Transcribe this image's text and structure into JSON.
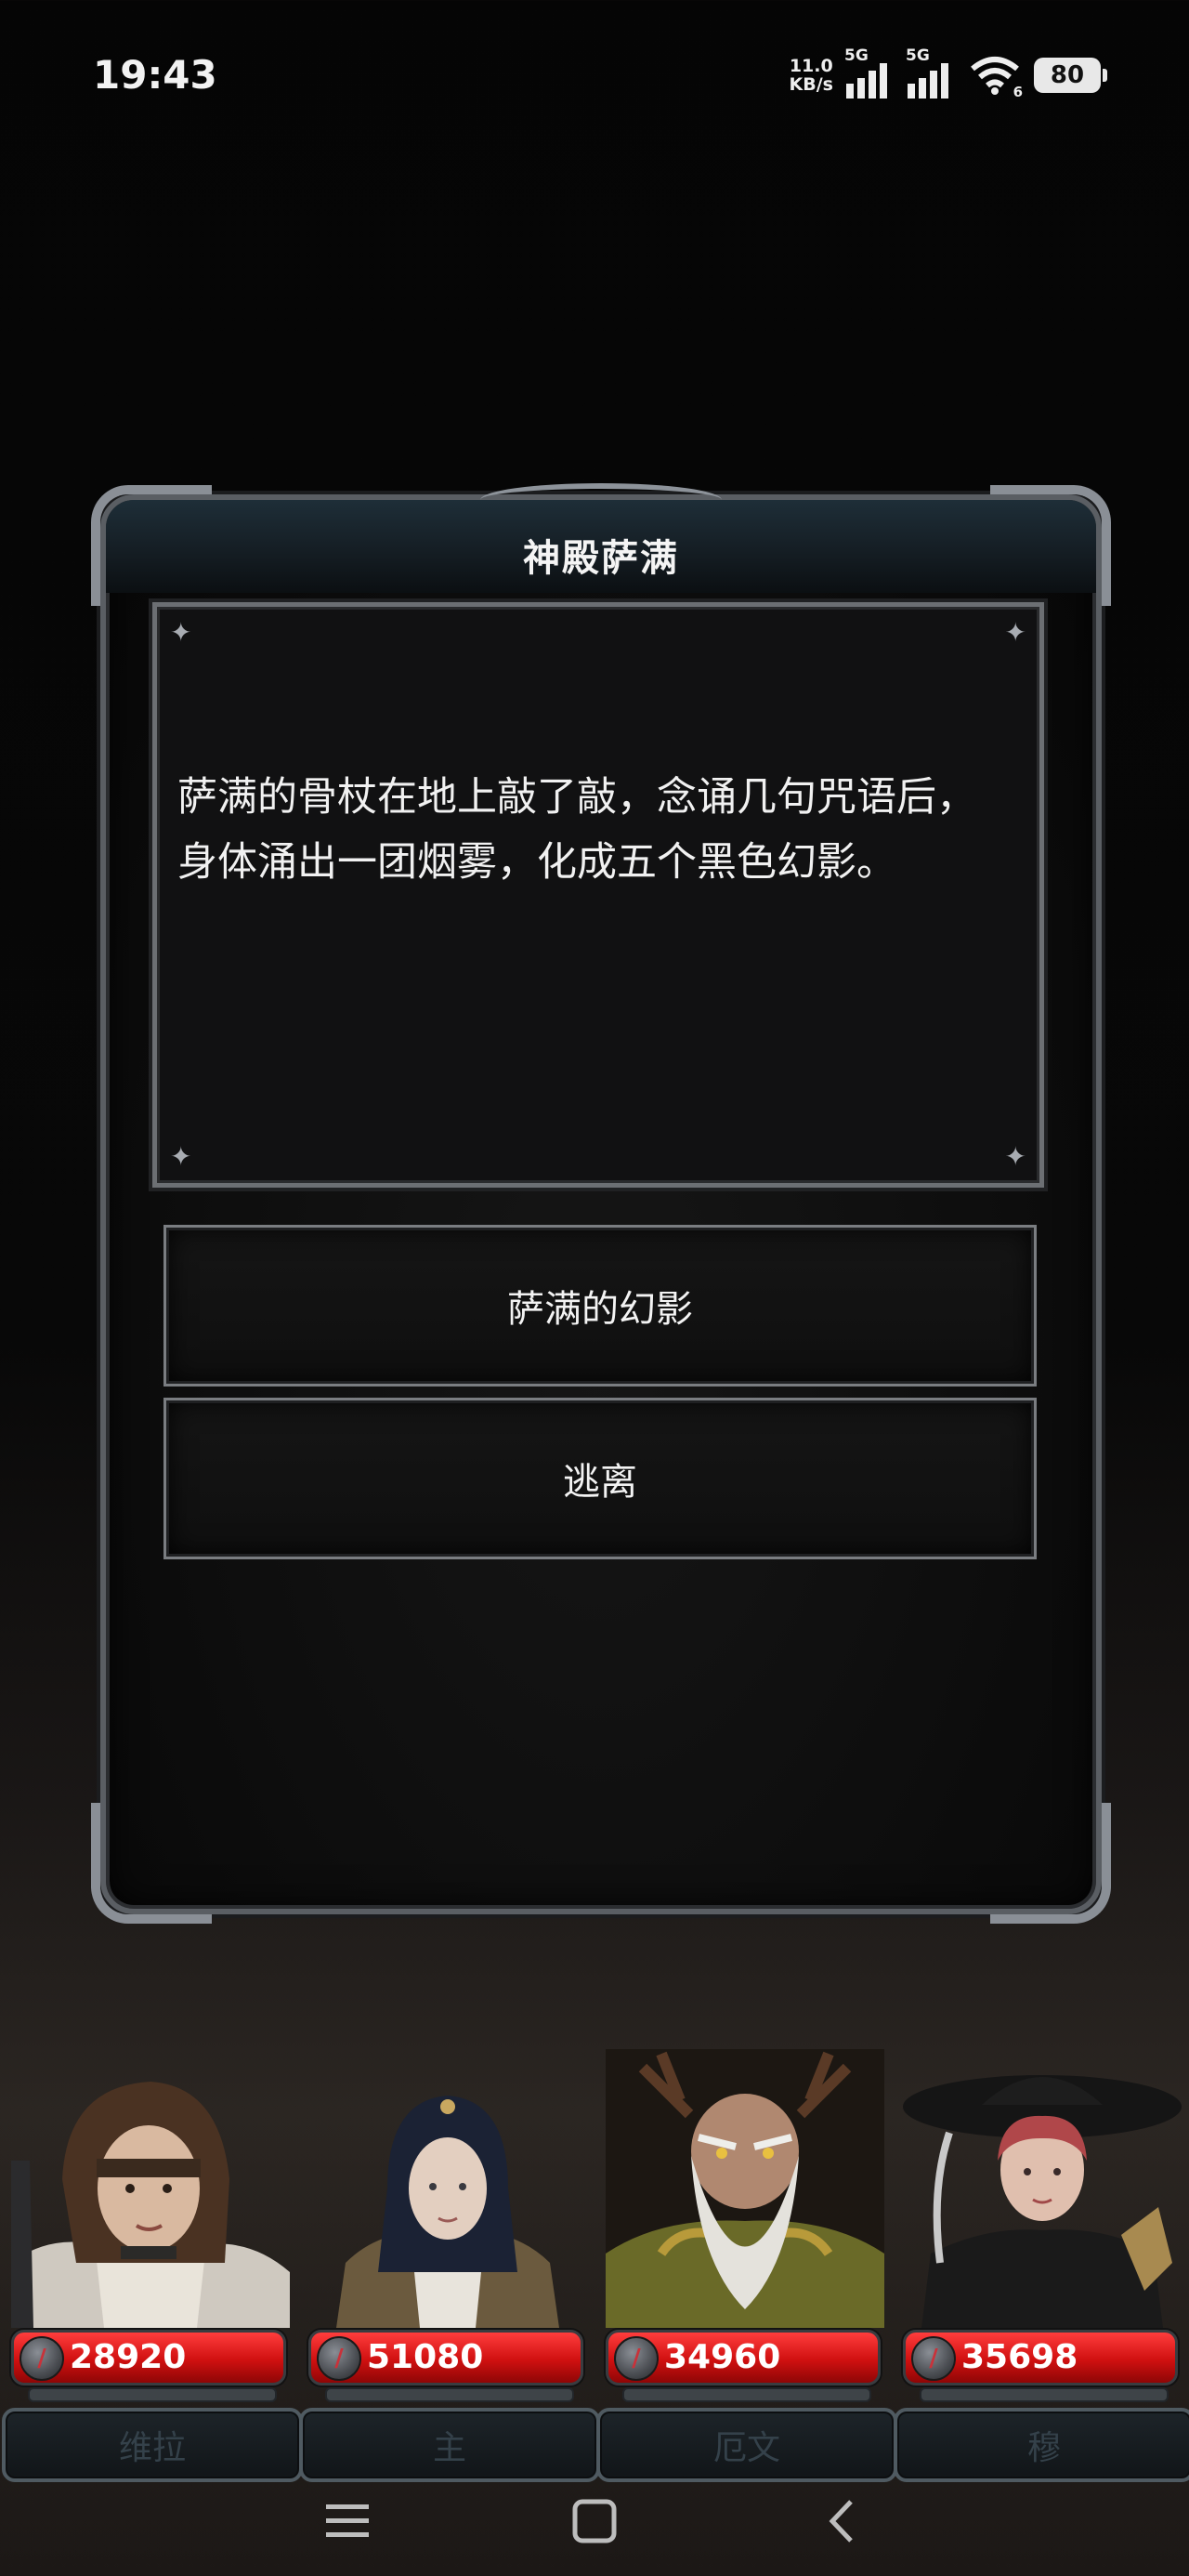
{
  "status_bar": {
    "time": "19:43",
    "net_speed_value": "11.0",
    "net_speed_unit": "KB/s",
    "sim1_label": "5G",
    "sim2_label": "5G",
    "wifi_badge": "6",
    "battery": "80"
  },
  "dialog": {
    "title": "神殿萨满",
    "story": "萨满的骨杖在地上敲了敲，念诵几句咒语后，身体涌出一团烟雾，化成五个黑色幻影。",
    "choices": [
      {
        "label": "萨满的幻影"
      },
      {
        "label": "逃离"
      }
    ]
  },
  "party": [
    {
      "name": "维拉",
      "hp": "28920"
    },
    {
      "name": "主",
      "hp": "51080"
    },
    {
      "name": "厄文",
      "hp": "34960"
    },
    {
      "name": "穆",
      "hp": "35698"
    }
  ],
  "nav": {
    "menu_icon": "menu-icon",
    "home_icon": "home-icon",
    "back_icon": "back-icon"
  },
  "colors": {
    "hp_red": "#d01010",
    "frame_silver": "#8a8f96",
    "background": "#080808"
  }
}
